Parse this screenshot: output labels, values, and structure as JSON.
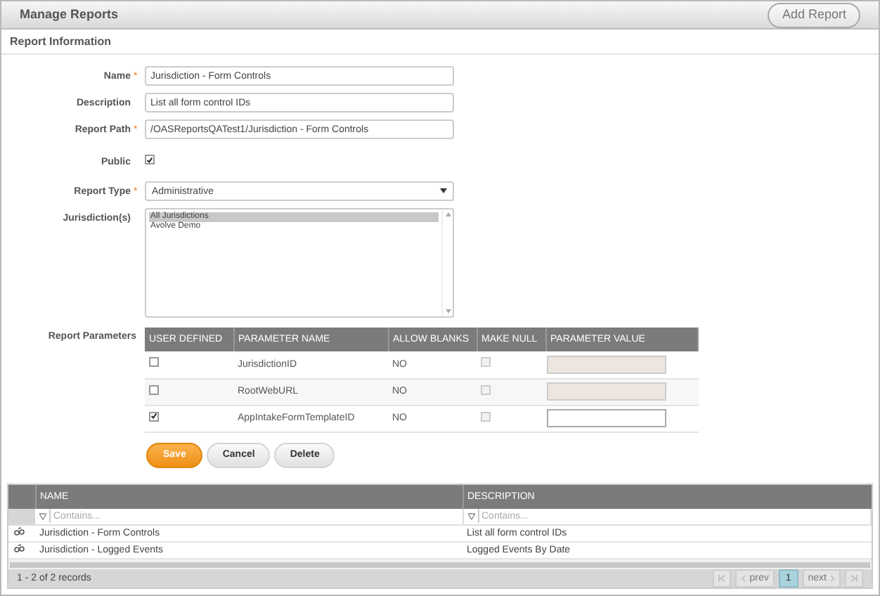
{
  "header": {
    "title": "Manage Reports",
    "action": "Add Report"
  },
  "section_title": "Report Information",
  "fields": [
    {
      "kind": "text",
      "label": "Name",
      "required_mark": "*",
      "value": "Jurisdiction - Form Controls"
    },
    {
      "kind": "text",
      "label": "Description",
      "value": "List all form control IDs"
    },
    {
      "kind": "text",
      "label": "Report Path",
      "required_mark": "*",
      "value": "/OASReportsQATest1/Jurisdiction - Form Controls"
    },
    {
      "kind": "checkbox",
      "label": "Public",
      "checked": true
    },
    {
      "kind": "select",
      "label": "Report Type",
      "required_mark": "*",
      "value": "Administrative"
    },
    {
      "kind": "listbox",
      "label": "Jurisdiction(s)",
      "options": [
        {
          "label": "All Jurisdictions",
          "selected": true
        },
        {
          "label": "Avolve Demo",
          "selected": false
        }
      ]
    }
  ],
  "parameters": {
    "label": "Report Parameters",
    "columns": [
      "USER DEFINED",
      "PARAMETER NAME",
      "ALLOW BLANKS",
      "MAKE NULL",
      "PARAMETER VALUE"
    ],
    "rows": [
      {
        "user_defined": false,
        "name": "JurisdictionID",
        "allow_blanks": "NO",
        "make_null": false
      },
      {
        "user_defined": false,
        "name": "RootWebURL",
        "allow_blanks": "NO",
        "make_null": false
      },
      {
        "user_defined": true,
        "name": "AppIntakeFormTemplateID",
        "allow_blanks": "NO",
        "make_null": false
      }
    ]
  },
  "buttons": [
    {
      "kind": "primary",
      "label": "Save"
    },
    {
      "kind": "default",
      "label": "Cancel"
    },
    {
      "kind": "default",
      "label": "Delete"
    }
  ],
  "grid": {
    "columns": [
      "NAME",
      "DESCRIPTION"
    ],
    "filters": [
      {
        "placeholder": "Contains..."
      },
      {
        "placeholder": "Contains..."
      }
    ],
    "rows": [
      {
        "name": "Jurisdiction - Form Controls",
        "description": "List all form control IDs"
      },
      {
        "name": "Jurisdiction - Logged Events",
        "description": "Logged Events By Date"
      }
    ],
    "status": "1 - 2 of 2 records",
    "pager": {
      "prev": "prev",
      "next": "next",
      "pages": [
        {
          "label": "1",
          "selected": true
        }
      ]
    }
  }
}
